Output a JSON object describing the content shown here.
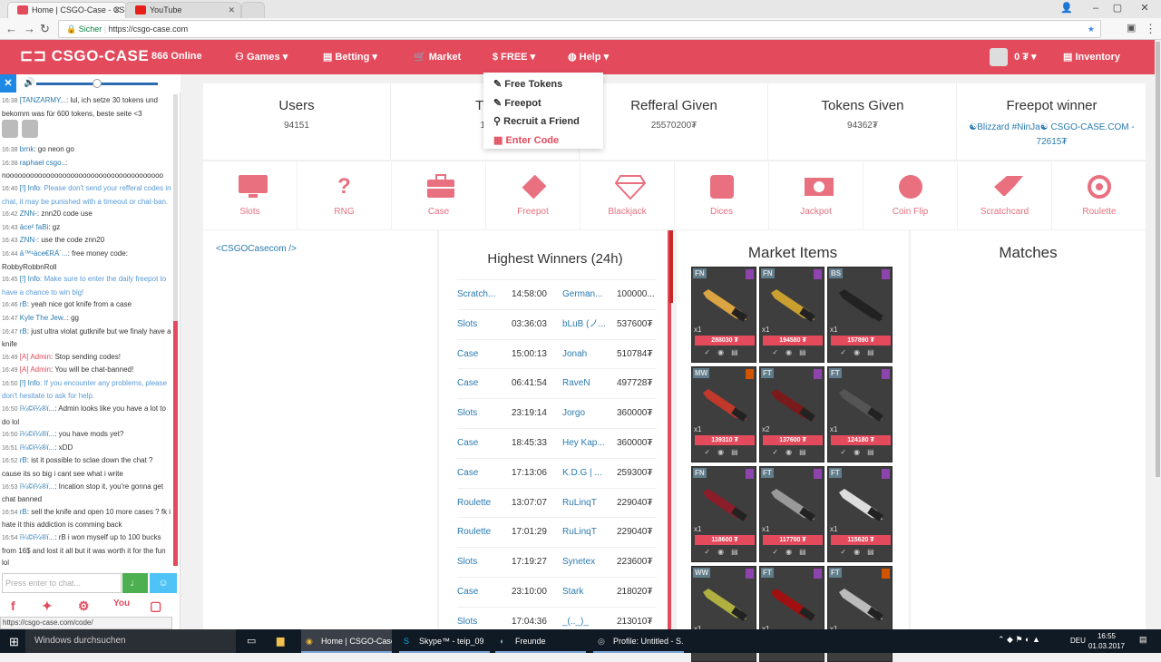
{
  "browser": {
    "tabs": [
      {
        "title": "Home | CSGO-Case - CS",
        "active": true
      },
      {
        "title": "YouTube",
        "active": false
      }
    ],
    "secure_label": "Sicher",
    "url": "https://csgo-case.com",
    "status_url": "https://csgo-case.com/code/"
  },
  "header": {
    "logo": "CSGO-CASE",
    "online": "866 Online",
    "nav": {
      "games": "Games",
      "betting": "Betting",
      "market": "Market",
      "free": "$ FREE",
      "help": "Help"
    },
    "balance": "0 ₮",
    "inventory": "Inventory"
  },
  "dropdown": {
    "items": [
      "Free Tokens",
      "Freepot",
      "Recruit a Friend",
      "Enter Code"
    ]
  },
  "stats": [
    {
      "label": "Users",
      "value": "94151"
    },
    {
      "label": "Tra",
      "value": "19"
    },
    {
      "label": "Refferal Given",
      "value": "25570200₮"
    },
    {
      "label": "Tokens Given",
      "value": "94362₮"
    },
    {
      "label": "Freepot winner",
      "value": "☯Blizzard #NinJa☯ CSGO-CASE.COM - 72615₮"
    }
  ],
  "games": [
    {
      "name": "Slots",
      "icon": "monitor-icon"
    },
    {
      "name": "RNG",
      "icon": "question-icon"
    },
    {
      "name": "Case",
      "icon": "briefcase-icon"
    },
    {
      "name": "Freepot",
      "icon": "ticket-icon"
    },
    {
      "name": "Blackjack",
      "icon": "diamond-icon"
    },
    {
      "name": "Dices",
      "icon": "dice-icon"
    },
    {
      "name": "Jackpot",
      "icon": "money-icon"
    },
    {
      "name": "Coin Flip",
      "icon": "coin-icon"
    },
    {
      "name": "Scratchcard",
      "icon": "eraser-icon"
    },
    {
      "name": "Roulette",
      "icon": "target-icon"
    }
  ],
  "twitter_link": "<CSGOCasecom />",
  "winners": {
    "title": "Highest Winners (24h)",
    "rows": [
      {
        "game": "Scratch...",
        "time": "14:58:00",
        "name": "German...",
        "value": "100000..."
      },
      {
        "game": "Slots",
        "time": "03:36:03",
        "name": "bLuB (ノ...",
        "value": "537600₮"
      },
      {
        "game": "Case",
        "time": "15:00:13",
        "name": "Jonah",
        "value": "510784₮"
      },
      {
        "game": "Case",
        "time": "06:41:54",
        "name": "RaveN",
        "value": "497728₮"
      },
      {
        "game": "Slots",
        "time": "23:19:14",
        "name": "Jorgo",
        "value": "360000₮"
      },
      {
        "game": "Case",
        "time": "18:45:33",
        "name": "Hey Kap...",
        "value": "360000₮"
      },
      {
        "game": "Case",
        "time": "17:13:06",
        "name": "K.D.G | ...",
        "value": "259300₮"
      },
      {
        "game": "Roulette",
        "time": "13:07:07",
        "name": "RuLinqT",
        "value": "229040₮"
      },
      {
        "game": "Roulette",
        "time": "17:01:29",
        "name": "RuLinqT",
        "value": "229040₮"
      },
      {
        "game": "Slots",
        "time": "17:19:27",
        "name": "Synetex",
        "value": "223600₮"
      },
      {
        "game": "Case",
        "time": "23:10:00",
        "name": "Stark",
        "value": "218020₮"
      },
      {
        "game": "Slots",
        "time": "17:04:36",
        "name": "_(.._)_",
        "value": "213010₮"
      }
    ]
  },
  "market": {
    "title": "Market Items",
    "items": [
      {
        "wear": "FN",
        "qty": "x1",
        "price": "288030 ₮",
        "rarity": "#8e44ad",
        "color": "#d9a441"
      },
      {
        "wear": "FN",
        "qty": "x1",
        "price": "194580 ₮",
        "rarity": "#8e44ad",
        "color": "#c9a030"
      },
      {
        "wear": "BS",
        "qty": "x1",
        "price": "157890 ₮",
        "rarity": "#8e44ad",
        "color": "#222222"
      },
      {
        "wear": "MW",
        "qty": "x1",
        "price": "139310 ₮",
        "rarity": "#d35400",
        "color": "#c0392b"
      },
      {
        "wear": "FT",
        "qty": "x2",
        "price": "137600 ₮",
        "rarity": "#8e44ad",
        "color": "#7b1a1a"
      },
      {
        "wear": "FT",
        "qty": "x1",
        "price": "124180 ₮",
        "rarity": "#8e44ad",
        "color": "#555555"
      },
      {
        "wear": "FN",
        "qty": "x1",
        "price": "118600 ₮",
        "rarity": "#8e44ad",
        "color": "#8b1c2a"
      },
      {
        "wear": "FT",
        "qty": "x1",
        "price": "117700 ₮",
        "rarity": "#8e44ad",
        "color": "#999999"
      },
      {
        "wear": "FT",
        "qty": "x1",
        "price": "115620 ₮",
        "rarity": "#8e44ad",
        "color": "#dddddd"
      },
      {
        "wear": "WW",
        "qty": "x1",
        "price": "",
        "rarity": "#8e44ad",
        "color": "#b0b040"
      },
      {
        "wear": "FT",
        "qty": "x1",
        "price": "",
        "rarity": "#8e44ad",
        "color": "#a01010"
      },
      {
        "wear": "FT",
        "qty": "x1",
        "price": "",
        "rarity": "#d35400",
        "color": "#bbbbbb"
      }
    ]
  },
  "matches": {
    "title": "Matches"
  },
  "chat": {
    "input_placeholder": "Press enter to chat...",
    "messages": [
      {
        "t": "16:38",
        "u": "[TANZARMY...",
        "m": ": lul, ich setze 30 tokens und bekomm was für 600 tokens, beste seite <3",
        "type": "normal"
      },
      {
        "t": "16:38",
        "u": "brnk",
        "m": ": go neon go",
        "type": "normal"
      },
      {
        "t": "16:38",
        "u": "raphael csgo..",
        "m": ": nooooooooooooooooooooooooooooooooooooooo",
        "type": "normal"
      },
      {
        "t": "16:40",
        "u": "[!] Info",
        "m": ": Please don't send your refferal codes in chat, it may be punished with a timeout or chat-ban.",
        "type": "info"
      },
      {
        "t": "16:42",
        "u": "ZNN-",
        "m": ": znn20 code use",
        "type": "normal"
      },
      {
        "t": "16:43",
        "u": "äce² faBi",
        "m": ": gz",
        "type": "normal"
      },
      {
        "t": "16:43",
        "u": "ZNN-",
        "m": ": use the code znn20",
        "type": "normal"
      },
      {
        "t": "16:44",
        "u": "ä™¹äce€RÄ´...",
        "m": ": free money code: RobbyRobbnRoll",
        "type": "normal"
      },
      {
        "t": "16:45",
        "u": "[!] Info",
        "m": ": Make sure to enter the daily freepot to have a chance to win big!",
        "type": "info"
      },
      {
        "t": "16:46",
        "u": "rB",
        "m": ": yeah nice got knife from a case",
        "type": "normal"
      },
      {
        "t": "16:47",
        "u": "Kyle The Jew..",
        "m": ": gg",
        "type": "normal"
      },
      {
        "t": "16:47",
        "u": "rB",
        "m": ": just ultra violat gutknife but we finaly have a knife",
        "type": "normal"
      },
      {
        "t": "16:49",
        "u": "[A] Admin",
        "m": ": Stop sending codes!",
        "type": "admin"
      },
      {
        "t": "16:49",
        "u": "[A] Admin",
        "m": ": You will be chat-banned!",
        "type": "admin"
      },
      {
        "t": "16:50",
        "u": "[!] Info",
        "m": ": If you encounter any problems, please don't hesitate to ask for help.",
        "type": "info"
      },
      {
        "t": "16:50",
        "u": "ï¼©ï¼®ï...",
        "m": ": Admin looks like you have a lot to do lol",
        "type": "normal"
      },
      {
        "t": "16:50",
        "u": "ï¼©ï¼®ï...",
        "m": ": you have mods yet?",
        "type": "normal"
      },
      {
        "t": "16:51",
        "u": "ï¼©ï¼®ï...",
        "m": ": xDD",
        "type": "normal"
      },
      {
        "t": "16:52",
        "u": "rB",
        "m": ": ist it possible to sclae down the chat ? cause its so big i cant see what i write",
        "type": "normal"
      },
      {
        "t": "16:53",
        "u": "ï¼©ï¼®ï...",
        "m": ": Incation stop it, you're gonna get chat banned",
        "type": "normal"
      },
      {
        "t": "16:54",
        "u": "rB",
        "m": ": sell the knife and open 10 more cases ? fk i hate it this addiction is comming back",
        "type": "normal"
      },
      {
        "t": "16:54",
        "u": "ï¼©ï¼®ï...",
        "m": ": rB i won myself up to 100 bucks from 16$ and lost it all but it was worth it for the fun lol",
        "type": "normal"
      }
    ]
  },
  "taskbar": {
    "search": "Windows durchsuchen",
    "apps": [
      "Home | CSGO-Case...",
      "Skype™ - teip_09",
      "Freunde",
      "Profile: Untitled - S..."
    ],
    "lang": "DEU",
    "time": "16:55",
    "date": "01.03.2017"
  }
}
